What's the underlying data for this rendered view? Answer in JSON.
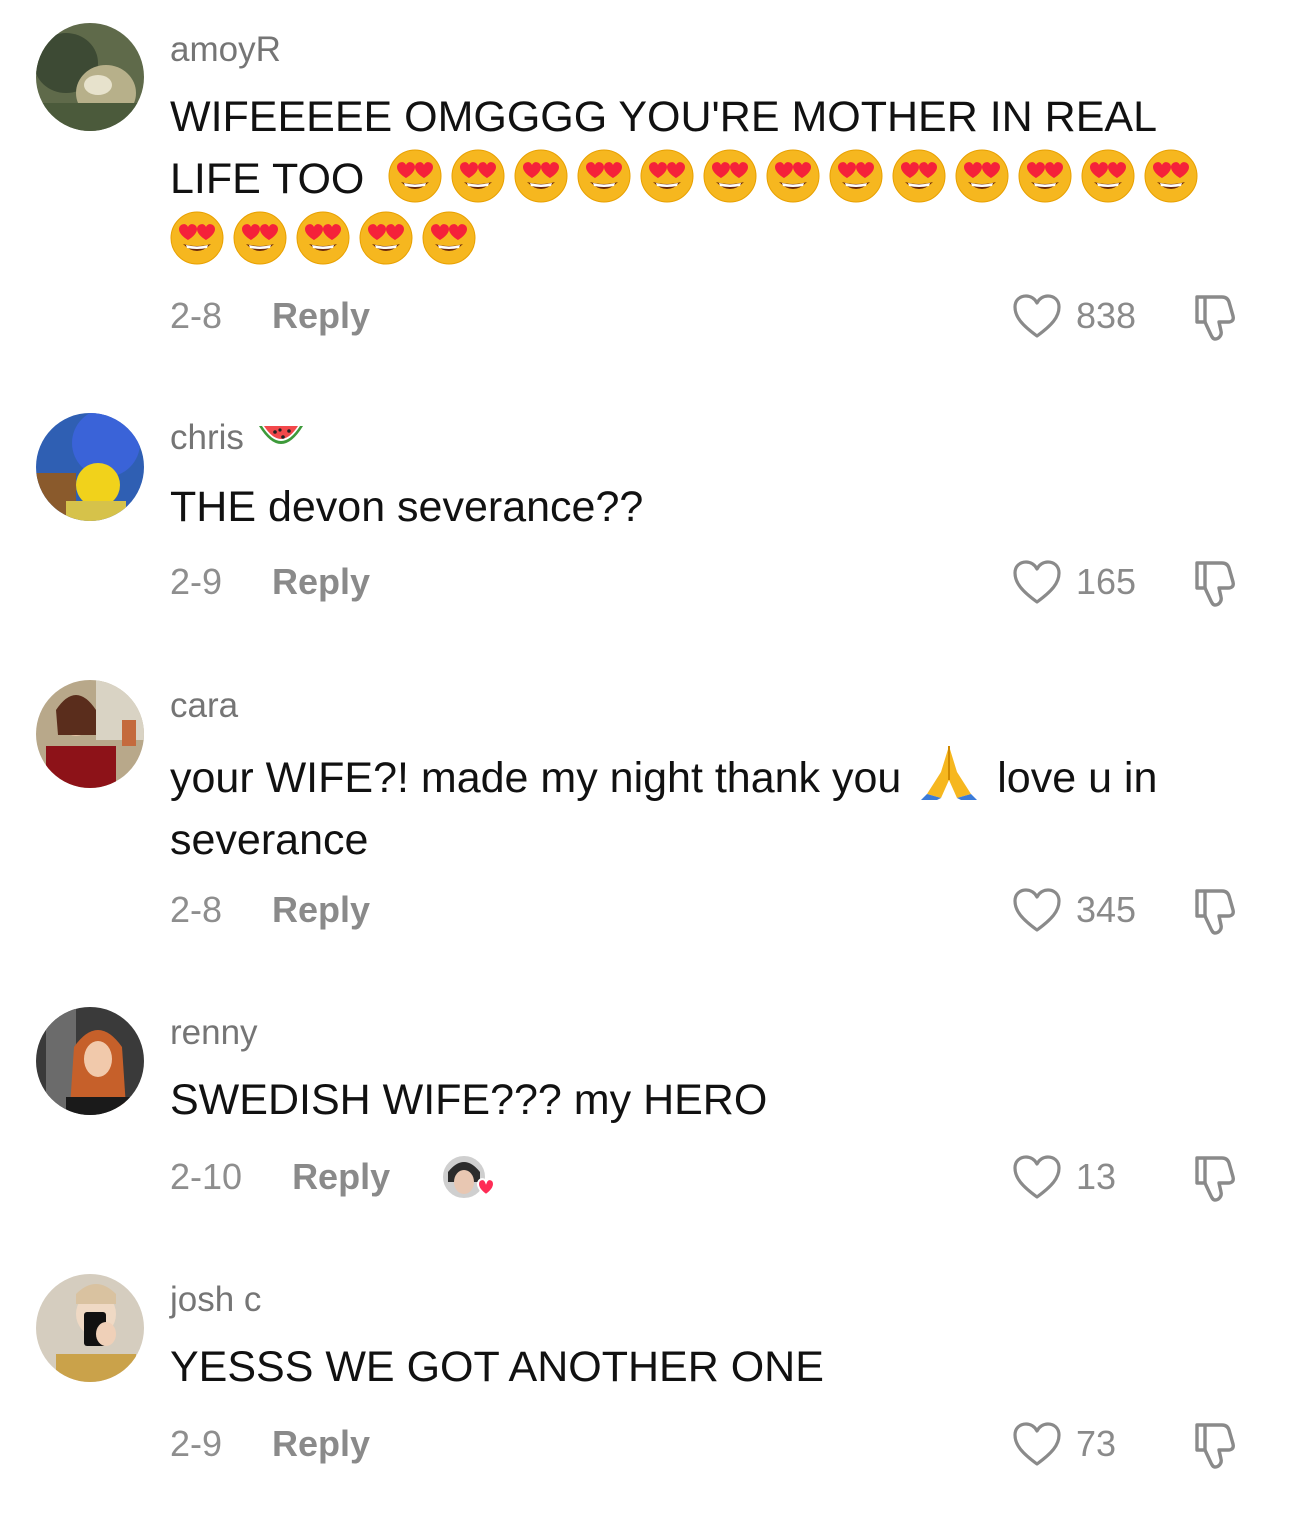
{
  "comments": [
    {
      "username": "amoyR",
      "text": "WIFEEEEE OMGGGG YOU'RE MOTHER IN REAL",
      "text_line2": "LIFE TOO",
      "emoji": "heart-eyes-emoji",
      "date": "2-8",
      "reply_label": "Reply",
      "likes": "838"
    },
    {
      "username": "chris",
      "username_emoji": "watermelon-emoji",
      "text": "THE devon severance??",
      "date": "2-9",
      "reply_label": "Reply",
      "likes": "165"
    },
    {
      "username": "cara",
      "text_before": "your WIFE?! made my night thank you",
      "text_after": "love u in",
      "text_line2": "severance",
      "emoji": "folded-hands-emoji",
      "date": "2-8",
      "reply_label": "Reply",
      "likes": "345"
    },
    {
      "username": "renny",
      "text": "SWEDISH WIFE??? my HERO",
      "date": "2-10",
      "reply_label": "Reply",
      "liked_by_creator": true,
      "likes": "13"
    },
    {
      "username": "josh c",
      "text": "YESSS WE GOT ANOTHER ONE",
      "date": "2-9",
      "reply_label": "Reply",
      "likes": "73"
    }
  ],
  "icons": {
    "like": "heart-outline-icon",
    "dislike": "thumbs-down-icon",
    "creator_like": "creator-liked-avatar-heart-icon"
  },
  "colors": {
    "background": "#ffffff",
    "text": "#111111",
    "muted": "#8a8a8a",
    "creator_heart": "#fe2c55"
  }
}
